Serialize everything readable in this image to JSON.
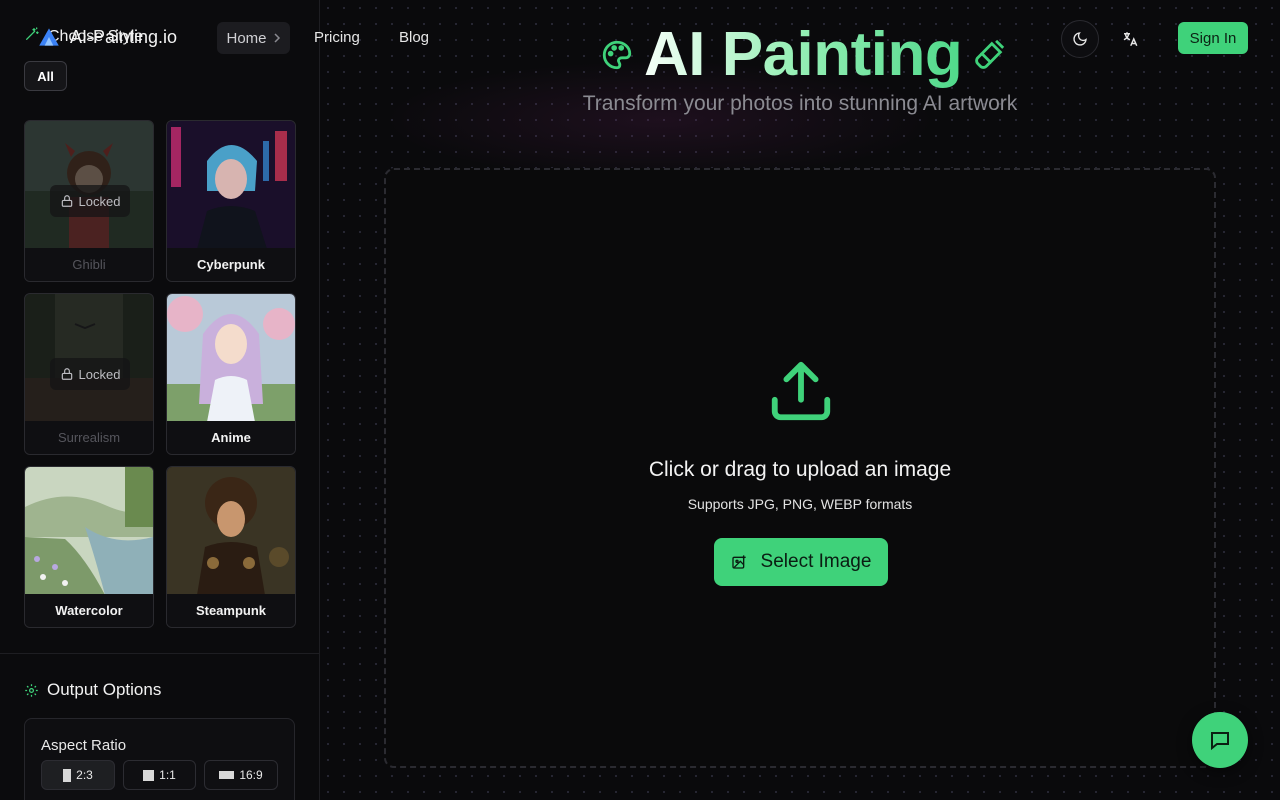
{
  "brand": {
    "name": "AI-Painting.io",
    "logo_icon": "logo-icon"
  },
  "nav": {
    "home": "Home",
    "pricing": "Pricing",
    "blog": "Blog",
    "sign_in": "Sign In",
    "theme_icon": "moon-icon",
    "language_icon": "translate-icon"
  },
  "sidebar": {
    "title": "Choose Style",
    "filter_all": "All",
    "styles": [
      {
        "label": "Ghibli",
        "locked": true,
        "lock_text": "Locked"
      },
      {
        "label": "Cyberpunk",
        "locked": false
      },
      {
        "label": "Surrealism",
        "locked": true,
        "lock_text": "Locked"
      },
      {
        "label": "Anime",
        "locked": false
      },
      {
        "label": "Watercolor",
        "locked": false
      },
      {
        "label": "Steampunk",
        "locked": false
      }
    ],
    "output_options": {
      "title": "Output Options",
      "aspect_ratio_label": "Aspect Ratio",
      "ratios": [
        "2:3",
        "1:1",
        "16:9"
      ],
      "selected_ratio": "2:3"
    }
  },
  "hero": {
    "title": "AI Painting",
    "subtitle": "Transform your photos into stunning AI artwork"
  },
  "upload": {
    "title": "Click or drag to upload an image",
    "formats": "Supports JPG, PNG, WEBP formats",
    "button": "Select Image"
  },
  "colors": {
    "accent": "#3fd27a",
    "background": "#09090b"
  }
}
